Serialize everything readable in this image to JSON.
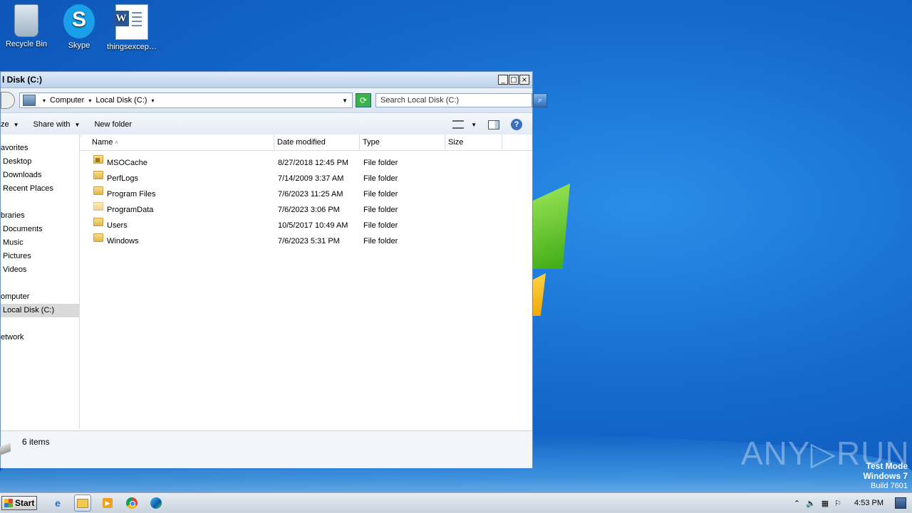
{
  "desktop": {
    "icons": [
      {
        "label": "Recycle Bin",
        "icon": "recycle-bin-icon"
      },
      {
        "label": "Skype",
        "icon": "skype-icon"
      },
      {
        "label": "thingsexcep…",
        "icon": "word-document-icon"
      }
    ],
    "watermark": "ANY▷RUN",
    "test_mode": {
      "line1": "Test Mode",
      "line2": "Windows 7",
      "line3": "Build 7601"
    }
  },
  "window": {
    "title": "l Disk (C:)",
    "controls": {
      "minimize": "_",
      "maximize": "□",
      "close": "×"
    },
    "address": {
      "crumbs": [
        "Computer",
        "Local Disk (C:)"
      ]
    },
    "search_placeholder": "Search Local Disk (C:)",
    "toolbar": {
      "organize": "ze",
      "share_with": "Share with",
      "new_folder": "New folder"
    },
    "nav": {
      "favorites_header": "avorites",
      "favorites": [
        "Desktop",
        "Downloads",
        "Recent Places"
      ],
      "libraries_header": "braries",
      "libraries": [
        "Documents",
        "Music",
        "Pictures",
        "Videos"
      ],
      "computer_header": "omputer",
      "computer_items": [
        "Local Disk (C:)"
      ],
      "network_header": "etwork"
    },
    "columns": {
      "name": "Name",
      "date": "Date modified",
      "type": "Type",
      "size": "Size"
    },
    "files": [
      {
        "name": "MSOCache",
        "date": "8/27/2018 12:45 PM",
        "type": "File folder",
        "size": ""
      },
      {
        "name": "PerfLogs",
        "date": "7/14/2009 3:37 AM",
        "type": "File folder",
        "size": ""
      },
      {
        "name": "Program Files",
        "date": "7/6/2023 11:25 AM",
        "type": "File folder",
        "size": ""
      },
      {
        "name": "ProgramData",
        "date": "7/6/2023 3:06 PM",
        "type": "File folder",
        "size": ""
      },
      {
        "name": "Users",
        "date": "10/5/2017 10:49 AM",
        "type": "File folder",
        "size": ""
      },
      {
        "name": "Windows",
        "date": "7/6/2023 5:31 PM",
        "type": "File folder",
        "size": ""
      }
    ],
    "status": {
      "count": "6 items"
    }
  },
  "taskbar": {
    "start_label": "Start",
    "apps": [
      "internet-explorer-icon",
      "windows-explorer-icon",
      "media-player-icon",
      "chrome-icon",
      "edge-icon"
    ],
    "clock": "4:53 PM"
  }
}
